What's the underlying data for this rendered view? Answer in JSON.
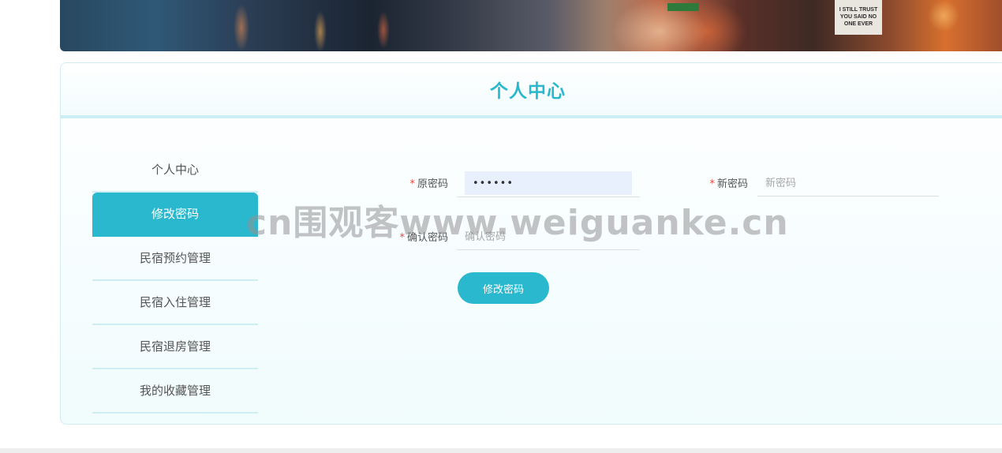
{
  "banner": {
    "sign_text": "I STILL TRUST YOU SAID NO ONE EVER"
  },
  "panel": {
    "title": "个人中心"
  },
  "menu": {
    "items": [
      {
        "label": "个人中心"
      },
      {
        "label": "修改密码",
        "active": true
      },
      {
        "label": "民宿预约管理"
      },
      {
        "label": "民宿入住管理"
      },
      {
        "label": "民宿退房管理"
      },
      {
        "label": "我的收藏管理"
      }
    ]
  },
  "form": {
    "required_mark": "*",
    "old_password": {
      "label": "原密码",
      "value": "••••••"
    },
    "new_password": {
      "label": "新密码",
      "placeholder": "新密码",
      "value": ""
    },
    "confirm_password": {
      "label": "确认密码",
      "placeholder": "确认密码",
      "value": ""
    },
    "submit_label": "修改密码"
  },
  "watermark": "cn围观客www.weiguanke.cn",
  "colors": {
    "accent": "#29b8cd",
    "required": "#e64a3b",
    "autofill": "#e8f0fe"
  }
}
